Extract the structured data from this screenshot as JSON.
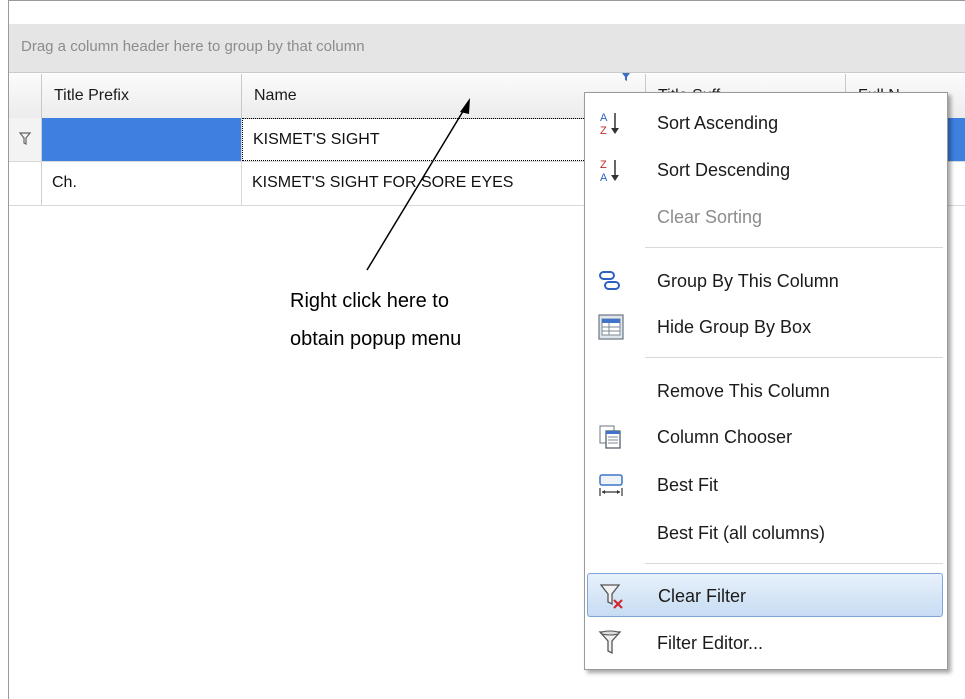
{
  "group_panel": {
    "hint": "Drag a column header here to group by that column"
  },
  "columns": [
    "Title Prefix",
    "Name",
    "Title Suff...",
    "Full N..."
  ],
  "rows": [
    {
      "prefix": "",
      "name": "KISMET'S SIGHT",
      "selected": true,
      "filter_row": true
    },
    {
      "prefix": "Ch.",
      "name": "KISMET'S SIGHT FOR SORE EYES",
      "selected": false
    }
  ],
  "menu": {
    "items": [
      {
        "label": "Sort Ascending",
        "icon": "sort-ascending-icon",
        "enabled": true
      },
      {
        "label": "Sort Descending",
        "icon": "sort-descending-icon",
        "enabled": true
      },
      {
        "label": "Clear Sorting",
        "icon": "",
        "enabled": false
      },
      {
        "label": "Group By This Column",
        "icon": "group-by-icon",
        "enabled": true
      },
      {
        "label": "Hide Group By Box",
        "icon": "group-box-icon",
        "enabled": true
      },
      {
        "label": "Remove This Column",
        "icon": "",
        "enabled": true
      },
      {
        "label": "Column Chooser",
        "icon": "column-chooser-icon",
        "enabled": true
      },
      {
        "label": "Best Fit",
        "icon": "best-fit-icon",
        "enabled": true
      },
      {
        "label": "Best Fit (all columns)",
        "icon": "",
        "enabled": true
      },
      {
        "label": "Clear Filter",
        "icon": "clear-filter-icon",
        "enabled": true,
        "highlighted": true
      },
      {
        "label": "Filter Editor...",
        "icon": "filter-editor-icon",
        "enabled": true
      }
    ]
  },
  "annotation": {
    "line1": "Right click here to",
    "line2": "obtain popup menu"
  },
  "colors": {
    "selection": "#3d80df",
    "menu_highlight": "#c7dcf3",
    "disabled_text": "#8c8c8c"
  }
}
